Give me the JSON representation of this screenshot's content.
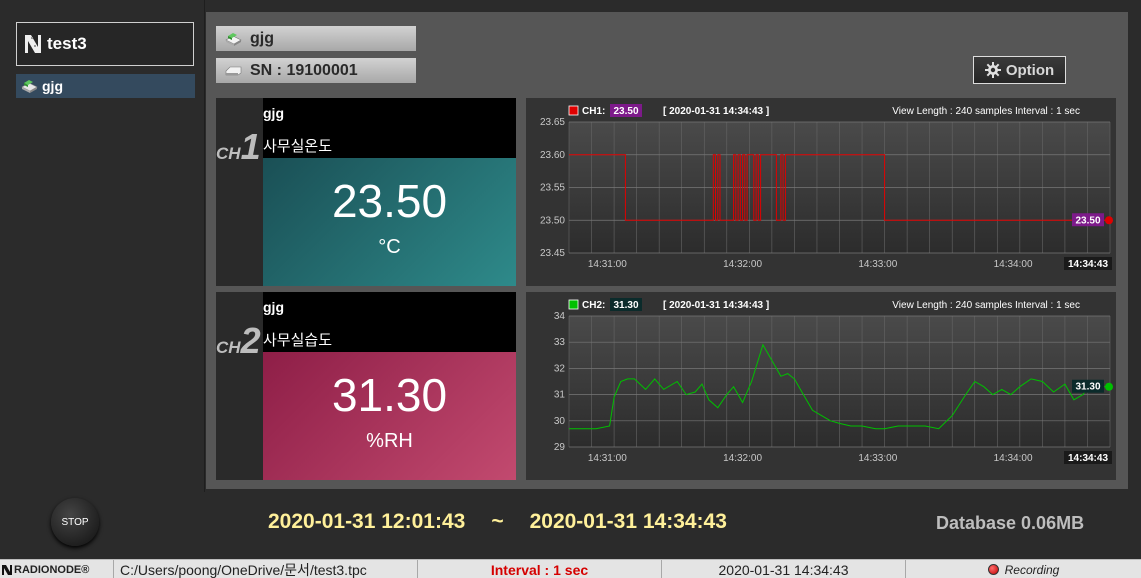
{
  "sidebar": {
    "root_label": "test3",
    "device_label": "gjg"
  },
  "header": {
    "device_name": "gjg",
    "serial": "SN : 19100001",
    "option_label": "Option"
  },
  "channels": [
    {
      "prefix": "CH",
      "number": "1",
      "device": "gjg",
      "name": "사무실온도",
      "value": "23.50",
      "unit": "°C",
      "color": "#e00000"
    },
    {
      "prefix": "CH",
      "number": "2",
      "device": "gjg",
      "name": "사무실습도",
      "value": "31.30",
      "unit": "%RH",
      "color": "#00c000"
    }
  ],
  "chart_data": [
    {
      "type": "line",
      "series_tag": "CH1:",
      "current_badge": "23.50",
      "timestamp": "[ 2020-01-31 14:34:43 ]",
      "view_info": "View Length : 240 samples   Interval : 1 sec",
      "end_label": "14:34:43",
      "ylim": [
        23.45,
        23.65
      ],
      "y_ticks": [
        "23.65",
        "23.60",
        "23.55",
        "23.50",
        "23.45"
      ],
      "x_ticks": [
        "14:31:00",
        "14:32:00",
        "14:33:00",
        "14:34:00"
      ],
      "x_tick_seconds": [
        17,
        77,
        137,
        197
      ],
      "line_color": "#e00000",
      "badge_color": "#7d1a8a",
      "series": [
        {
          "x": [
            0,
            25,
            25,
            64,
            64,
            65,
            65,
            66,
            66,
            67,
            67,
            73,
            73,
            74,
            74,
            75,
            75,
            76,
            76,
            77,
            77,
            78,
            78,
            79,
            79,
            82,
            82,
            83,
            83,
            84,
            84,
            85,
            85,
            92,
            92,
            94,
            94,
            95,
            95,
            96,
            96,
            140,
            140,
            240
          ],
          "y": [
            23.6,
            23.6,
            23.5,
            23.5,
            23.6,
            23.6,
            23.5,
            23.5,
            23.6,
            23.6,
            23.5,
            23.5,
            23.6,
            23.6,
            23.5,
            23.5,
            23.6,
            23.6,
            23.5,
            23.5,
            23.6,
            23.6,
            23.5,
            23.5,
            23.6,
            23.6,
            23.5,
            23.5,
            23.6,
            23.6,
            23.5,
            23.5,
            23.6,
            23.6,
            23.5,
            23.5,
            23.6,
            23.6,
            23.5,
            23.5,
            23.6,
            23.6,
            23.5,
            23.5
          ]
        }
      ]
    },
    {
      "type": "line",
      "series_tag": "CH2:",
      "current_badge": "31.30",
      "timestamp": "[ 2020-01-31 14:34:43 ]",
      "view_info": "View Length : 240 samples   Interval : 1 sec",
      "end_label": "14:34:43",
      "ylim": [
        29,
        34
      ],
      "y_ticks": [
        "34",
        "33",
        "32",
        "31",
        "30",
        "29"
      ],
      "x_ticks": [
        "14:31:00",
        "14:32:00",
        "14:33:00",
        "14:34:00"
      ],
      "x_tick_seconds": [
        17,
        77,
        137,
        197
      ],
      "line_color": "#00c000",
      "badge_color": "#0b2b2b",
      "series": [
        {
          "x": [
            0,
            12,
            18,
            20,
            23,
            26,
            29,
            34,
            38,
            42,
            48,
            52,
            56,
            59,
            62,
            66,
            70,
            73,
            77,
            81,
            86,
            90,
            94,
            97,
            100,
            104,
            108,
            112,
            116,
            120,
            125,
            130,
            136,
            140,
            146,
            152,
            158,
            164,
            170,
            176,
            180,
            184,
            188,
            192,
            196,
            200,
            205,
            210,
            215,
            220,
            224,
            228,
            232,
            236,
            240
          ],
          "y": [
            29.7,
            29.7,
            29.8,
            30.9,
            31.5,
            31.6,
            31.6,
            31.2,
            31.6,
            31.2,
            31.5,
            31.0,
            31.1,
            31.4,
            30.8,
            30.5,
            31.0,
            31.3,
            30.7,
            31.5,
            32.9,
            32.3,
            31.7,
            31.8,
            31.6,
            31.0,
            30.4,
            30.2,
            30.0,
            29.9,
            29.8,
            29.8,
            29.7,
            29.7,
            29.8,
            29.8,
            29.8,
            29.7,
            30.2,
            31.0,
            31.5,
            31.3,
            31.0,
            31.2,
            31.0,
            31.3,
            31.6,
            31.5,
            31.1,
            31.4,
            30.8,
            31.0,
            31.5,
            31.3,
            31.3
          ]
        }
      ]
    }
  ],
  "bottom": {
    "stop_label": "STOP",
    "range_start": "2020-01-31 12:01:43",
    "range_sep": "~",
    "range_end": "2020-01-31 14:34:43",
    "db_label": "Database",
    "db_size": "0.06MB"
  },
  "statusbar": {
    "logo": "RADIONODE®",
    "path": "C:/Users/poong/OneDrive/문서/test3.tpc",
    "interval": "Interval : 1 sec",
    "time": "2020-01-31 14:34:43",
    "recording": "Recording"
  },
  "icons": {
    "root": "radionode-logo-icon",
    "device": "device-icon",
    "sn": "sensor-icon",
    "option": "gear-icon"
  }
}
